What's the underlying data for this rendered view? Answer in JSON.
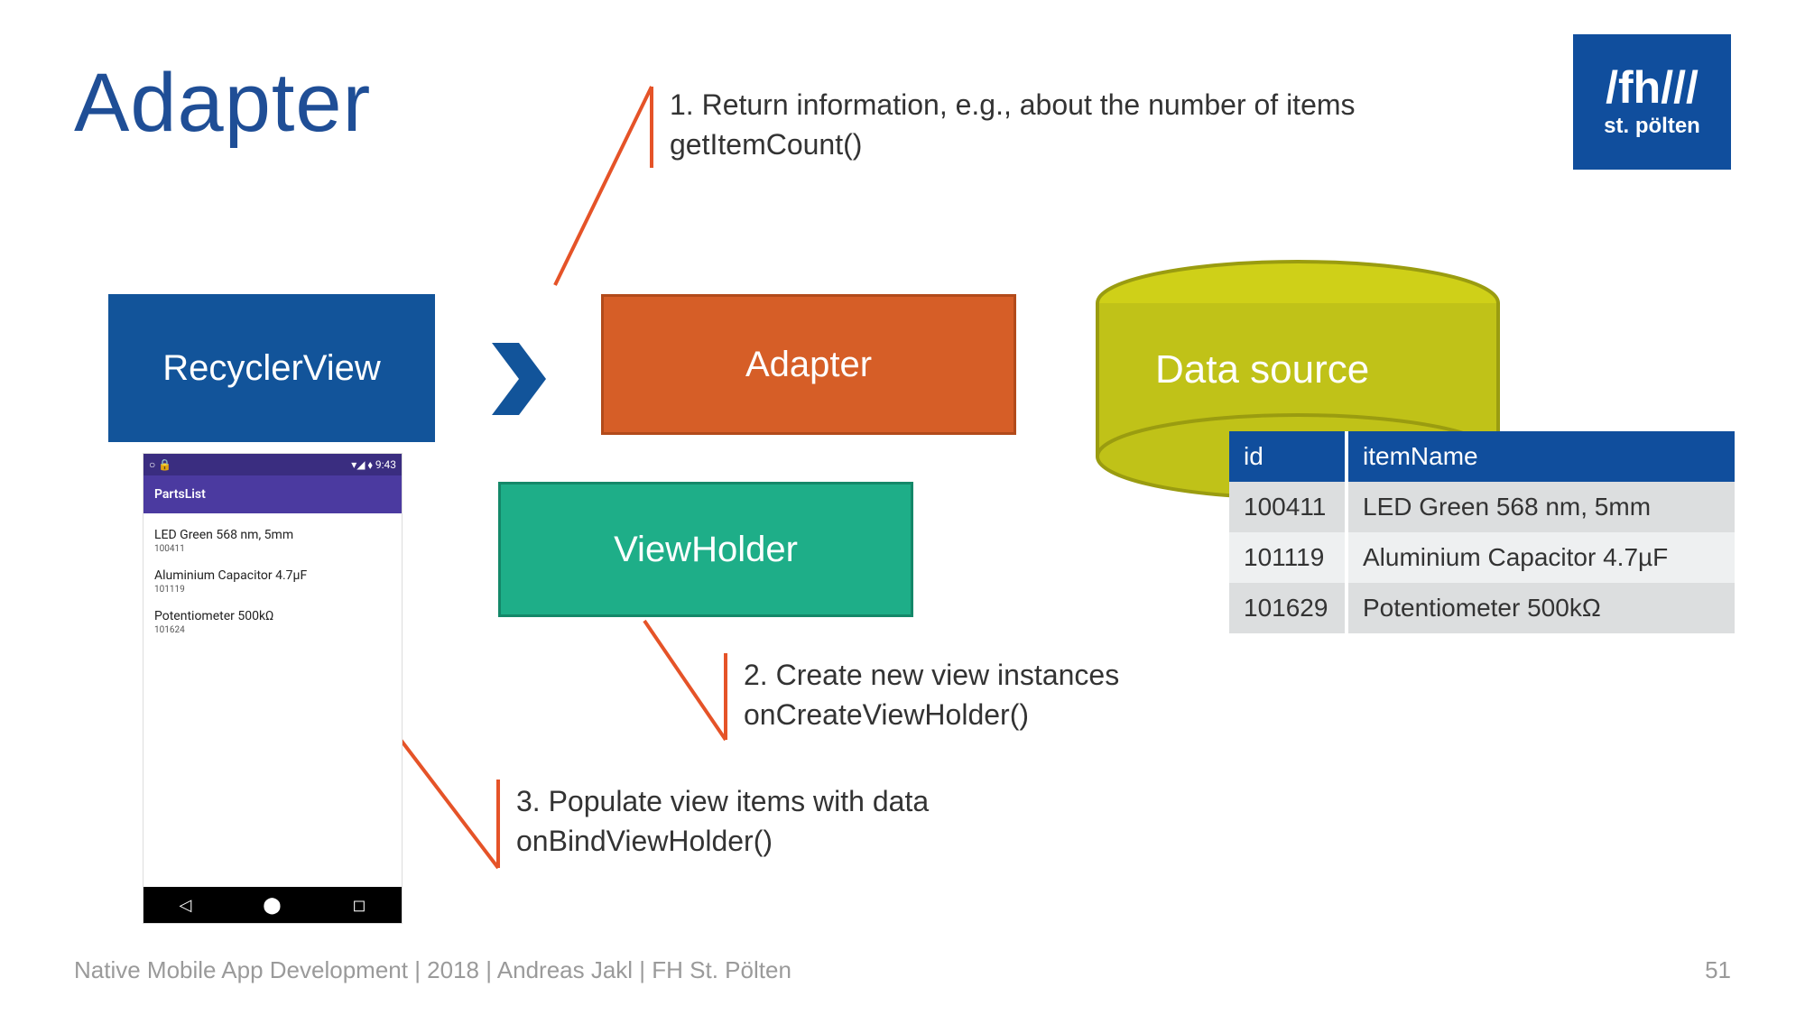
{
  "title": "Adapter",
  "logo": {
    "line1": "/fh///",
    "line2": "st. pölten"
  },
  "boxes": {
    "recyclerView": "RecyclerView",
    "adapter": "Adapter",
    "viewHolder": "ViewHolder",
    "dataSource": "Data source"
  },
  "annotations": {
    "a1_line1": "1. Return information, e.g., about the number of items",
    "a1_line2": "getItemCount()",
    "a2_line1": "2. Create new view instances",
    "a2_line2": "onCreateViewHolder()",
    "a3_line1": "3. Populate view items with data",
    "a3_line2": "onBindViewHolder()"
  },
  "phone": {
    "status_left": "○  🔒",
    "status_right": "▾◢ ⬧ 9:43",
    "appTitle": "PartsList",
    "rows": [
      {
        "name": "LED Green 568 nm, 5mm",
        "id": "100411"
      },
      {
        "name": "Aluminium Capacitor 4.7µF",
        "id": "101119"
      },
      {
        "name": "Potentiometer 500kΩ",
        "id": "101624"
      }
    ],
    "nav": {
      "back": "◁",
      "home": "⬤",
      "recent": "◻"
    }
  },
  "table": {
    "head": {
      "c1": "id",
      "c2": "itemName"
    },
    "rows": [
      {
        "id": "100411",
        "name": "LED Green 568 nm, 5mm"
      },
      {
        "id": "101119",
        "name": "Aluminium Capacitor 4.7µF"
      },
      {
        "id": "101629",
        "name": "Potentiometer 500kΩ"
      }
    ]
  },
  "footer": "Native Mobile App Development | 2018 | Andreas Jakl | FH St. Pölten",
  "page": "51",
  "colors": {
    "blue": "#104e9d",
    "orange_box": "#d65e27",
    "green_box": "#1eae88",
    "olive": "#c0c218",
    "callout": "#e55328"
  }
}
